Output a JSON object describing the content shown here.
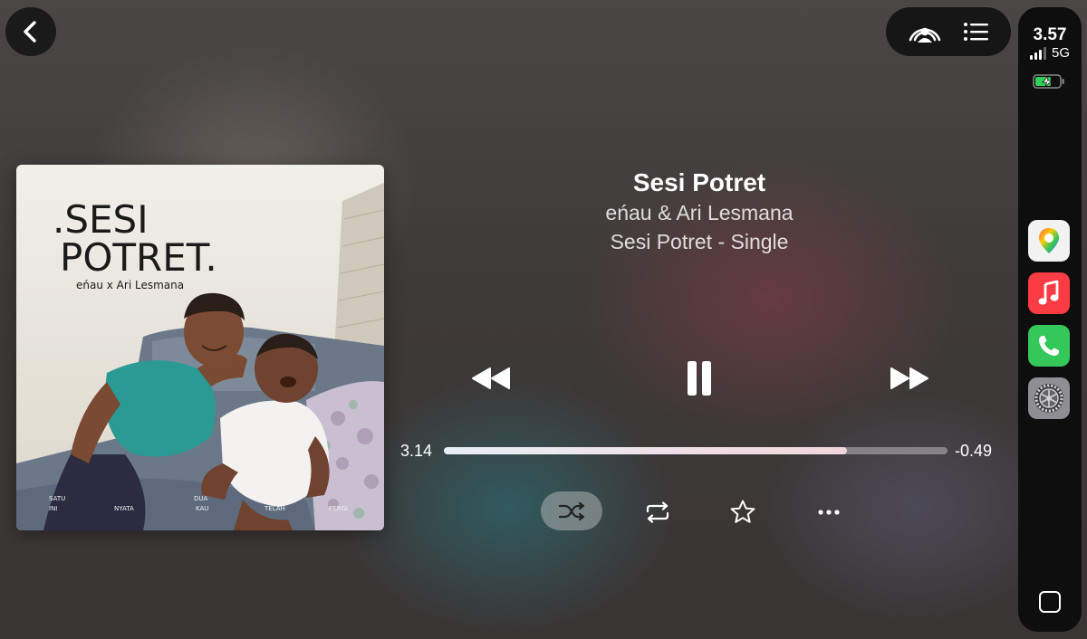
{
  "status": {
    "time": "3.57",
    "network": "5G",
    "signal_bars": 3,
    "signal_total": 4,
    "charging": true
  },
  "track": {
    "title": "Sesi Potret",
    "artist": "eńau & Ari Lesmana",
    "album": "Sesi Potret - Single"
  },
  "album_art": {
    "title_line1": ".SESI",
    "title_line2": "POTRET.",
    "credit": "eńau x Ari Lesmana",
    "tracklist": [
      "SATU",
      "INI",
      "NYATA",
      "DUA",
      "KAU",
      "TELAH",
      "PERGI"
    ]
  },
  "progress": {
    "elapsed": "3.14",
    "remaining": "-0.49",
    "fraction": 0.8
  },
  "icons": {
    "back": "chevron-left-icon",
    "now_playing": "airplay-icon",
    "queue": "list-icon",
    "rewind": "rewind-icon",
    "pause": "pause-icon",
    "forward": "fast-forward-icon",
    "shuffle": "shuffle-icon",
    "repeat": "repeat-icon",
    "favorite": "star-icon",
    "more": "more-icon"
  },
  "dock_apps": [
    "maps",
    "music",
    "phone",
    "settings"
  ],
  "colors": {
    "music_red": "#fc3c44",
    "phone_green": "#34c759",
    "battery_green": "#30d158"
  }
}
